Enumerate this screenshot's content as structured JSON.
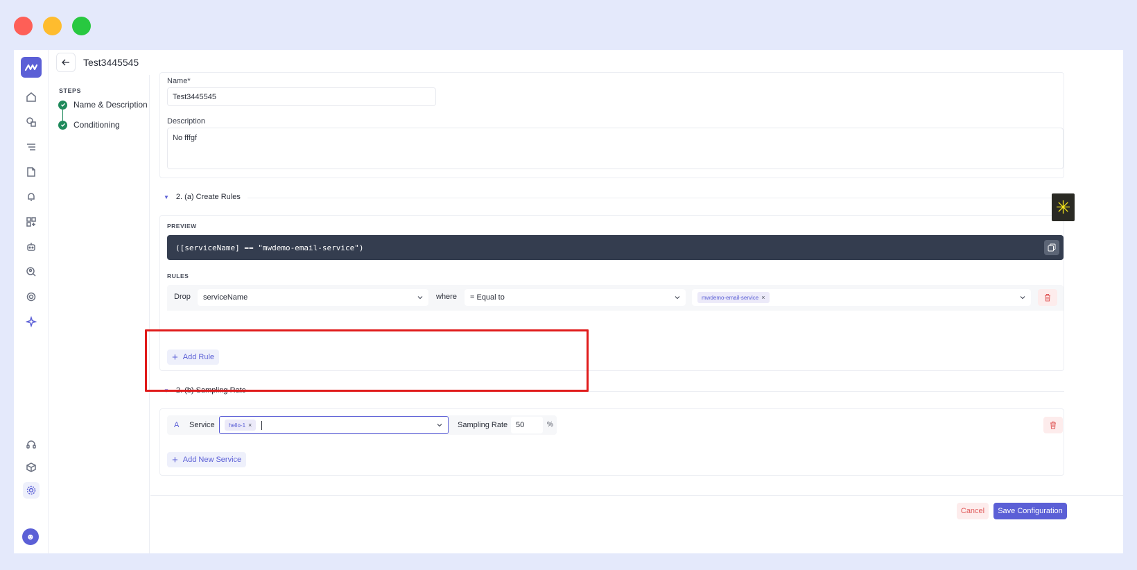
{
  "header": {
    "title": "Test3445545"
  },
  "steps": {
    "title": "STEPS",
    "items": [
      {
        "label": "Name & Description"
      },
      {
        "label": "Conditioning"
      }
    ]
  },
  "form": {
    "name_label": "Name*",
    "name_value": "Test3445545",
    "description_label": "Description",
    "description_value": "No fffgf"
  },
  "rules_section": {
    "title": "2. (a) Create Rules",
    "preview_label": "PREVIEW",
    "preview_text": "([serviceName] == \"mwdemo-email-service\")",
    "rules_label": "RULES",
    "rule": {
      "action": "Drop",
      "field": "serviceName",
      "where": "where",
      "operator": "= Equal to",
      "value_tag": "mwdemo-email-service"
    },
    "add_rule_label": "Add Rule"
  },
  "sampling_section": {
    "title": "2. (b) Sampling Rate",
    "row": {
      "letter": "A",
      "service_label": "Service",
      "service_tag": "hello-1",
      "rate_label": "Sampling Rate",
      "rate_value": "50",
      "unit": "%"
    },
    "add_service_label": "Add New Service"
  },
  "footer": {
    "cancel_label": "Cancel",
    "save_label": "Save Configuration"
  },
  "colors": {
    "accent": "#5b5fd6",
    "success": "#1f8a5b",
    "danger": "#e05a5a",
    "highlight": "#e01b1b",
    "preview_bg": "#343d4f"
  },
  "icons": {
    "rail": [
      "home-icon",
      "apm-icon",
      "logs-icon",
      "reports-icon",
      "alerts-icon",
      "dashboard-add-icon",
      "bot-icon",
      "user-search-icon",
      "integrations-icon",
      "sparkle-icon",
      "support-icon",
      "package-icon",
      "settings-icon"
    ]
  }
}
